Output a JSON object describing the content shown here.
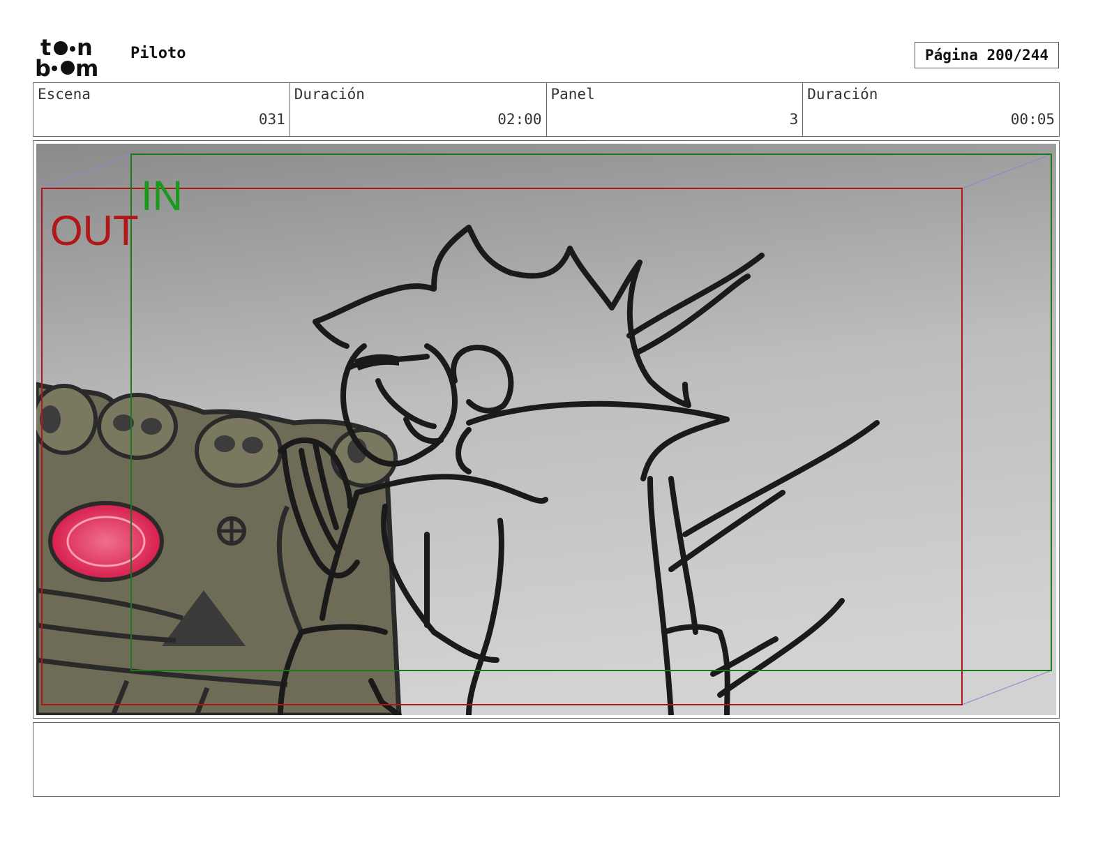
{
  "header": {
    "logo_text": "toonboom",
    "project_title": "Piloto",
    "page_label": "Página 200/244"
  },
  "info": {
    "scene_label": "Escena",
    "scene_value": "031",
    "scene_duration_label": "Duración",
    "scene_duration_value": "02:00",
    "panel_label": "Panel",
    "panel_value": "3",
    "panel_duration_label": "Duración",
    "panel_duration_value": "00:05"
  },
  "panel": {
    "out_label": "OUT",
    "in_label": "IN",
    "colors": {
      "out_frame": "#b01818",
      "in_frame": "#1a8a1a",
      "perspective": "#8a8ad0",
      "bg_top": "#8e8e8e",
      "bg_bottom": "#d4d4d4",
      "skull_pile": "#6e6c56",
      "gem": "#e0305a"
    }
  },
  "notes": {
    "text": ""
  }
}
